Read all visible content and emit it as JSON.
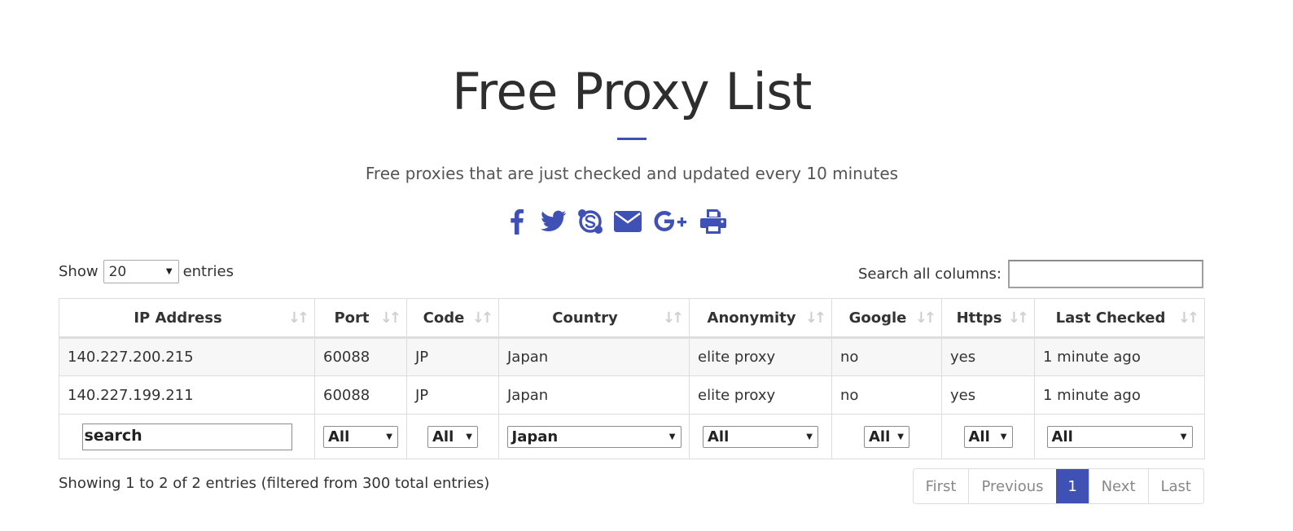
{
  "header": {
    "title": "Free Proxy List",
    "subtitle": "Free proxies that are just checked and updated every 10 minutes",
    "accent_color": "#3f51b5"
  },
  "share_icons": [
    "facebook-icon",
    "twitter-icon",
    "skype-icon",
    "email-icon",
    "google-plus-icon",
    "print-icon"
  ],
  "length_control": {
    "prefix": "Show",
    "value": "20",
    "suffix": "entries"
  },
  "global_search": {
    "label": "Search all columns:",
    "value": ""
  },
  "table": {
    "columns": [
      "IP Address",
      "Port",
      "Code",
      "Country",
      "Anonymity",
      "Google",
      "Https",
      "Last Checked"
    ],
    "rows": [
      [
        "140.227.200.215",
        "60088",
        "JP",
        "Japan",
        "elite proxy",
        "no",
        "yes",
        "1 minute ago"
      ],
      [
        "140.227.199.211",
        "60088",
        "JP",
        "Japan",
        "elite proxy",
        "no",
        "yes",
        "1 minute ago"
      ]
    ],
    "filters": {
      "ip_placeholder": "search",
      "port": "All",
      "code": "All",
      "country": "Japan",
      "anonymity": "All",
      "google": "All",
      "https": "All",
      "last_checked": "All"
    }
  },
  "info": "Showing 1 to 2 of 2 entries (filtered from 300 total entries)",
  "pagination": {
    "first": "First",
    "previous": "Previous",
    "current": "1",
    "next": "Next",
    "last": "Last"
  }
}
